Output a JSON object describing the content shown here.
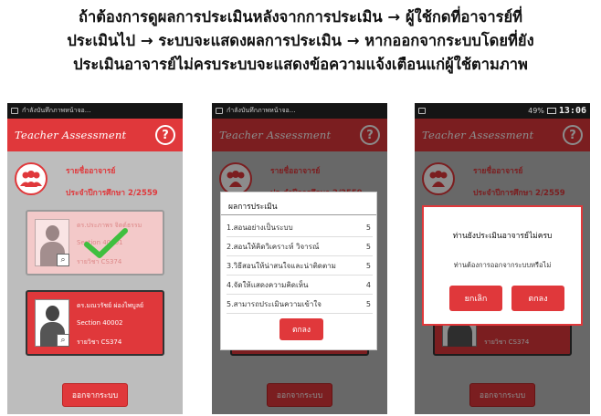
{
  "caption": {
    "line1": "ถ้าต้องการดูผลการประเมินหลังจากการประเมิน → ผู้ใช้กดที่อาจารย์ที่",
    "line2": "ประเมินไป → ระบบจะแสดงผลการประเมิน → หากออกจากระบบโดยที่ยัง",
    "line3": "ประเมินอาจารย์ไม่ครบระบบจะแสดงข้อความแจ้งเตือนแก่ผู้ใช้ตามภาพ"
  },
  "status_bar": {
    "notification": "กำลังบันทึกภาพหน้าจอ...",
    "battery": "49%",
    "time": "13:06"
  },
  "app": {
    "title": "Teacher Assessment",
    "help": "?",
    "list_title": "รายชื่ออาจารย์",
    "list_subtitle": "ประจำปีการศึกษา 2/2559",
    "logout_label": "ออกจากระบบ",
    "accent": "#e0383b"
  },
  "teachers": [
    {
      "name": "ดร.ประภาพร จิตต์ธรรม",
      "section": "Section 40001",
      "subject": "รายวิชา CS374",
      "evaluated": true
    },
    {
      "name": "ดร.มณวรัชย์ ผ่องไพบูลย์",
      "section": "Section 40002",
      "subject": "รายวิชา CS374",
      "evaluated": false
    }
  ],
  "result_dialog": {
    "title": "ผลการประเมิน",
    "rows": [
      {
        "label": "1.สอนอย่างเป็นระบบ",
        "score": "5"
      },
      {
        "label": "2.สอนให้คิดวิเคราะห์ วิจารณ์",
        "score": "5"
      },
      {
        "label": "3.วิธีสอนให้น่าสนใจและน่าติดตาม",
        "score": "5"
      },
      {
        "label": "4.จัดให้แสดงความคิดเห็น",
        "score": "4"
      },
      {
        "label": "5.สามารถประเมินความเข้าใจ",
        "score": "5"
      }
    ],
    "ok_label": "ตกลง"
  },
  "alert_dialog": {
    "title": "ท่านยังประเมินอาจารย์ไม่ครบ",
    "message": "ท่านต้องการออกจากระบบหรือไม่",
    "cancel_label": "ยกเลิก",
    "ok_label": "ตกลง"
  }
}
